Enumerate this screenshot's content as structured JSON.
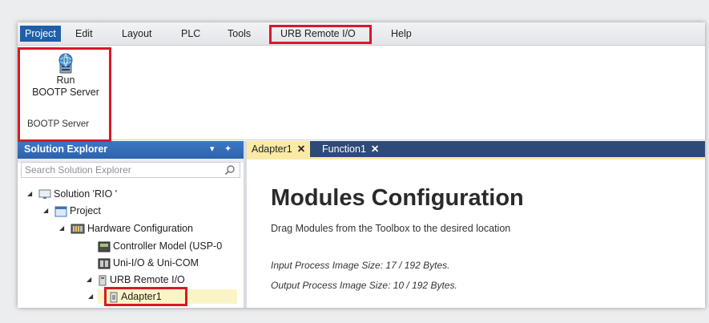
{
  "menu": {
    "items": [
      "Project",
      "Edit",
      "Layout",
      "PLC",
      "Tools",
      "URB Remote I/O",
      "Help"
    ]
  },
  "ribbon": {
    "run_button_line1": "Run",
    "run_button_line2": "BOOTP Server",
    "group_label": "BOOTP Server"
  },
  "solution_explorer": {
    "title": "Solution Explorer",
    "pin": "▾ ✦",
    "search_placeholder": "Search Solution Explorer",
    "tree": [
      "Solution 'RIO '",
      "Project",
      "Hardware Configuration",
      "Controller Model (USP-0",
      "Uni-I/O & Uni-COM",
      "URB Remote I/O",
      "Adapter1"
    ]
  },
  "tabs": [
    {
      "label": "Adapter1",
      "close": "✕"
    },
    {
      "label": "Function1",
      "close": "✕"
    }
  ],
  "content": {
    "title": "Modules Configuration",
    "subtitle": "Drag Modules from the Toolbox to the desired location",
    "input_size": "Input Process Image Size: 17 / 192 Bytes.",
    "output_size": "Output Process Image Size: 10 / 192 Bytes."
  },
  "colors": {
    "accent": "#1f5fa8",
    "highlight_box": "#d8182a",
    "active_tab": "#fbe9a6",
    "tabbar": "#2e4a79"
  },
  "icons": [
    "globe-server-icon",
    "search-icon",
    "solution-icon",
    "project-icon",
    "hardware-icon",
    "controller-icon",
    "module-icon",
    "adapter-icon"
  ]
}
